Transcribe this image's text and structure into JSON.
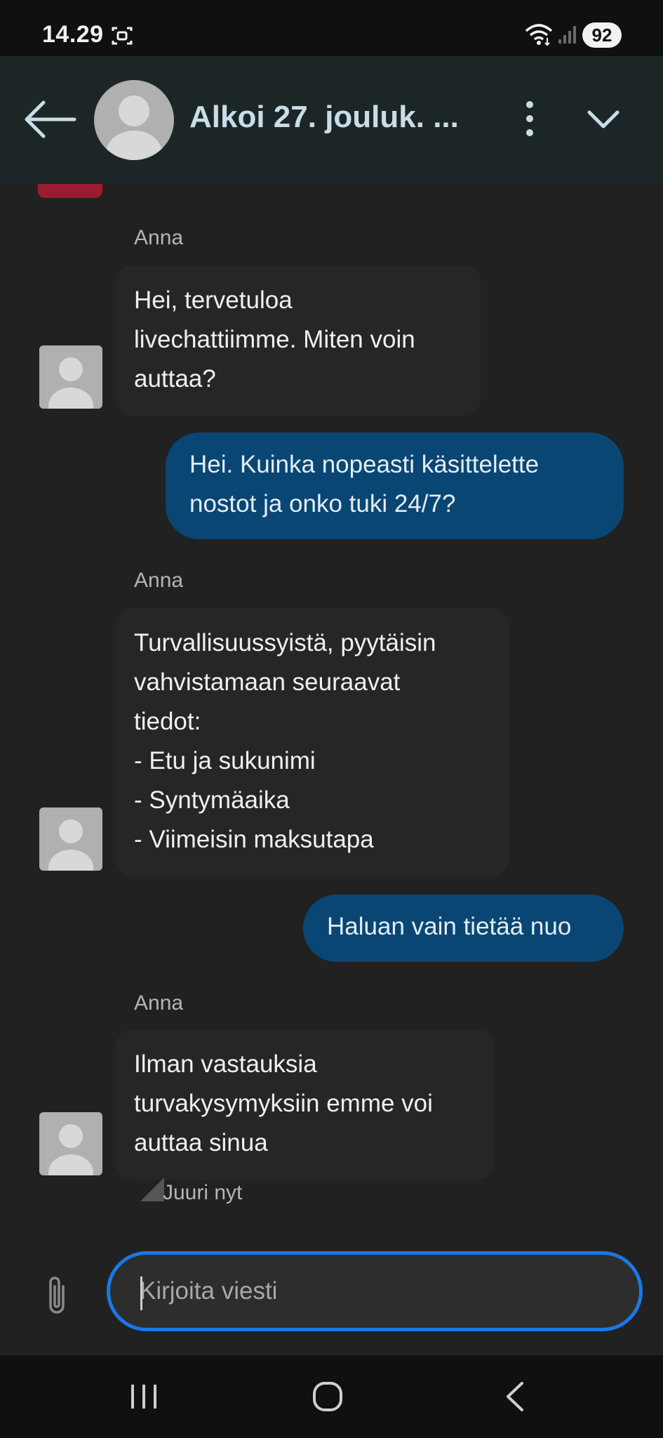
{
  "status_bar": {
    "time": "14.29",
    "battery": "92"
  },
  "header": {
    "title": "Alkoi 27. jouluk. ..."
  },
  "messages": [
    {
      "sender": "Anna",
      "text": "Hei, tervetuloa\nlivechattiimme. Miten voin\nauttaa?"
    },
    {
      "text": "Hei. Kuinka nopeasti käsittelette\nnostot ja onko tuki 24/7?"
    },
    {
      "sender": "Anna",
      "text": "Turvallisuussyistä, pyytäisin\nvahvistamaan seuraavat\ntiedot:\n- Etu ja sukunimi\n- Syntymäaika\n- Viimeisin maksutapa"
    },
    {
      "text": "Haluan vain tietää nuo"
    },
    {
      "sender": "Anna",
      "text": "Ilman vastauksia\nturvakysymyksiin emme voi\nauttaa sinua"
    }
  ],
  "timestamp": "Juuri nyt",
  "composer": {
    "placeholder": "Kirjoita viesti"
  },
  "colors": {
    "accent": "#1a78e6",
    "user_bubble": "#094674",
    "header": "#1d2626"
  }
}
